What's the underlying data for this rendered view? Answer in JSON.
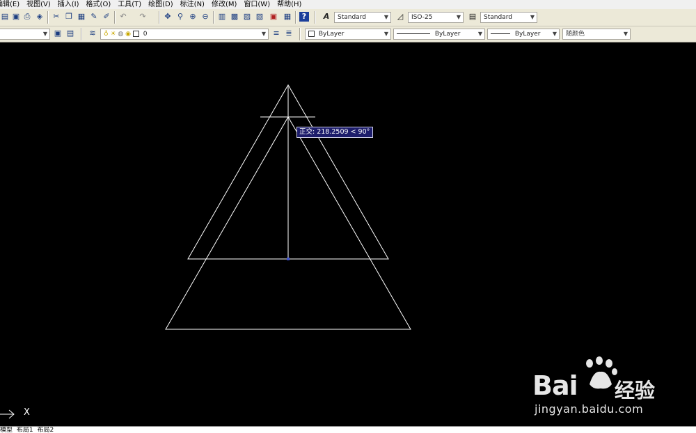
{
  "menubar": {
    "items": [
      "编辑(E)",
      "视图(V)",
      "插入(I)",
      "格式(O)",
      "工具(T)",
      "绘图(D)",
      "标注(N)",
      "修改(M)",
      "窗口(W)",
      "帮助(H)"
    ]
  },
  "styles_toolbar": {
    "text_style": "Standard",
    "dim_style": "ISO-25",
    "table_style": "Standard"
  },
  "layers_toolbar": {
    "layer_name": "0"
  },
  "properties_toolbar": {
    "color": "ByLayer",
    "linetype": "ByLayer",
    "lineweight": "ByLayer",
    "plot_style": "随颜色"
  },
  "drawing": {
    "tooltip": "正交: 218.2509 < 90°",
    "ucs_x_label": "X",
    "line_color": "#ffffff",
    "background": "#000000"
  },
  "layout_tabs": [
    "模型",
    "布局1",
    "布局2"
  ],
  "watermark": {
    "brand": "Bai",
    "brand_suffix": "经验",
    "url": "jingyan.baidu.com"
  }
}
